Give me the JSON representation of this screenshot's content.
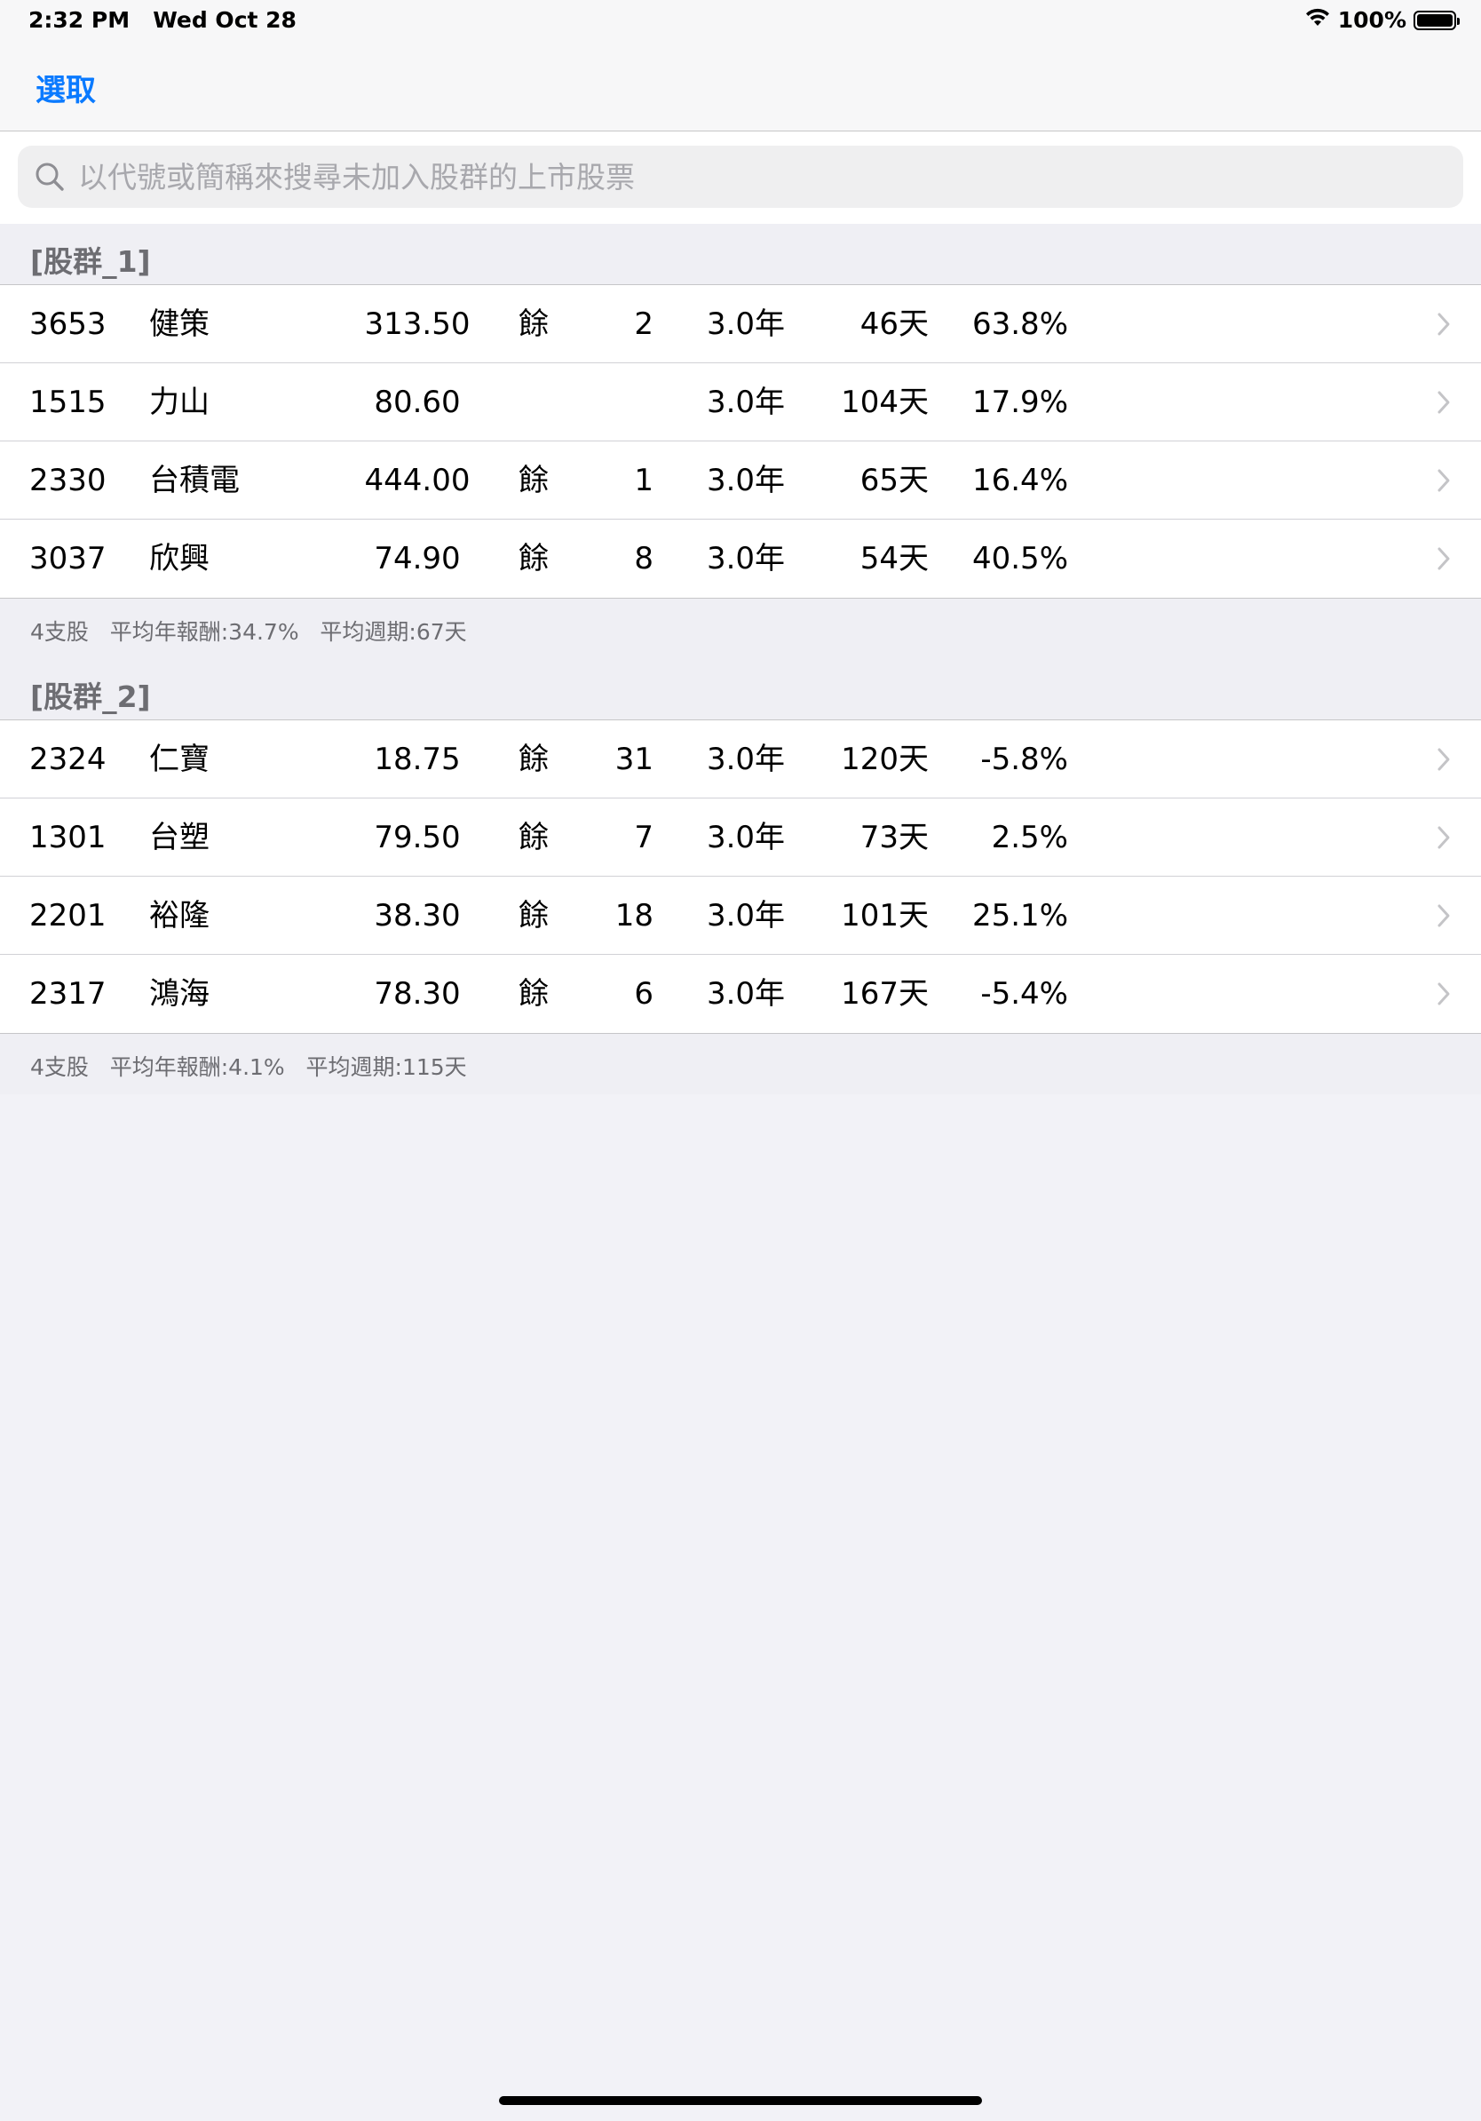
{
  "status_bar": {
    "time": "2:32 PM   Wed Oct 28",
    "battery": "100%"
  },
  "nav": {
    "select_label": "選取"
  },
  "search": {
    "placeholder": "以代號或簡稱來搜尋未加入股群的上市股票"
  },
  "groups": [
    {
      "title": "[股群_1]",
      "footer": "4支股   平均年報酬:34.7%   平均週期:67天",
      "rows": [
        {
          "code": "3653",
          "name": "健策",
          "price": "313.50",
          "rem": "餘",
          "count": "2",
          "years": "3.0年",
          "days": "46天",
          "pct": "63.8%"
        },
        {
          "code": "1515",
          "name": "力山",
          "price": "80.60",
          "rem": "",
          "count": "",
          "years": "3.0年",
          "days": "104天",
          "pct": "17.9%"
        },
        {
          "code": "2330",
          "name": "台積電",
          "price": "444.00",
          "rem": "餘",
          "count": "1",
          "years": "3.0年",
          "days": "65天",
          "pct": "16.4%"
        },
        {
          "code": "3037",
          "name": "欣興",
          "price": "74.90",
          "rem": "餘",
          "count": "8",
          "years": "3.0年",
          "days": "54天",
          "pct": "40.5%"
        }
      ]
    },
    {
      "title": "[股群_2]",
      "footer": "4支股   平均年報酬:4.1%   平均週期:115天",
      "rows": [
        {
          "code": "2324",
          "name": "仁寶",
          "price": "18.75",
          "rem": "餘",
          "count": "31",
          "years": "3.0年",
          "days": "120天",
          "pct": "-5.8%"
        },
        {
          "code": "1301",
          "name": "台塑",
          "price": "79.50",
          "rem": "餘",
          "count": "7",
          "years": "3.0年",
          "days": "73天",
          "pct": "2.5%"
        },
        {
          "code": "2201",
          "name": "裕隆",
          "price": "38.30",
          "rem": "餘",
          "count": "18",
          "years": "3.0年",
          "days": "101天",
          "pct": "25.1%"
        },
        {
          "code": "2317",
          "name": "鴻海",
          "price": "78.30",
          "rem": "餘",
          "count": "6",
          "years": "3.0年",
          "days": "167天",
          "pct": "-5.4%"
        }
      ]
    }
  ],
  "colors": {
    "accent": "#0a7aff",
    "background": "#f2f2f7",
    "secondary_text": "#6d6d72"
  }
}
